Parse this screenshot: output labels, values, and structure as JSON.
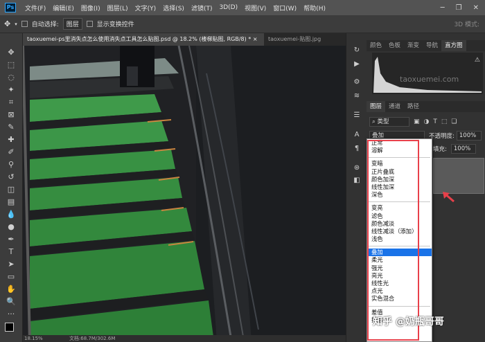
{
  "menubar": {
    "logo": "Ps",
    "items": [
      "文件(F)",
      "编辑(E)",
      "图像(I)",
      "图层(L)",
      "文字(Y)",
      "选择(S)",
      "滤镜(T)",
      "3D(D)",
      "视图(V)",
      "窗口(W)",
      "帮助(H)"
    ]
  },
  "options_bar": {
    "auto_select_label": "自动选择:",
    "auto_select_value": "图层",
    "transform_label": "显示变换控件",
    "mode_3d": "3D 模式:"
  },
  "tabs": [
    {
      "label": "taoxuemei-ps里消失点怎么使用消失点工具怎么贴图.psd @ 18.2% (楼梯贴图, RGB/8) *  ×"
    },
    {
      "label": "taoxuemei-贴图.jpg"
    }
  ],
  "panels": {
    "top_tabs": [
      "颜色",
      "色板",
      "渐变",
      "导航",
      "直方图"
    ],
    "histogram_watermark": "taoxuemei.com",
    "layer_tabs": [
      "图层",
      "通道",
      "路径"
    ],
    "filter_label": "类型",
    "blend_value": "叠加",
    "opacity_label": "不透明度:",
    "opacity_value": "100%",
    "fill_label": "填充:",
    "fill_value": "100%"
  },
  "blend_modes": {
    "groups": [
      [
        "正常",
        "溶解"
      ],
      [
        "变暗",
        "正片叠底",
        "颜色加深",
        "线性加深",
        "深色"
      ],
      [
        "变亮",
        "滤色",
        "颜色减淡",
        "线性减淡（添加）",
        "浅色"
      ],
      [
        "叠加",
        "柔光",
        "强光",
        "亮光",
        "线性光",
        "点光",
        "实色混合"
      ],
      [
        "差值",
        "排除"
      ]
    ],
    "selected": "叠加"
  },
  "status": {
    "zoom": "18.15%",
    "doc": "文档:68.7M/302.6M"
  },
  "watermark": {
    "site": "知乎",
    "author": "@奶瓶哥哥"
  },
  "colors": {
    "accent": "#31a8ff",
    "highlight_red": "#e8404a",
    "selected_blue": "#1a73e8",
    "stair_green": "#2f8a3c"
  }
}
